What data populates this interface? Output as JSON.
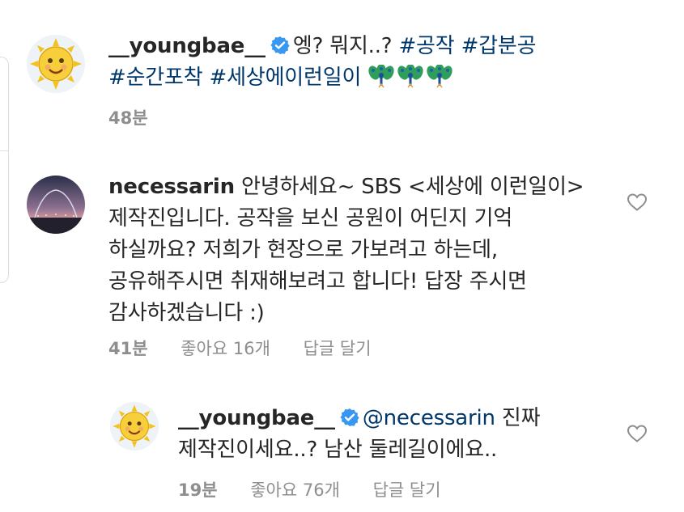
{
  "comments": [
    {
      "username": "__youngbae__",
      "verified": true,
      "text_plain": "엥? 뭐지..? ",
      "hashtags_line1": [
        "#공작",
        "#갑분공"
      ],
      "hashtags_line2": [
        "#순간포착",
        "#세상에이런일이"
      ],
      "emoji": [
        "peacock",
        "peacock",
        "peacock"
      ],
      "time": "48분"
    },
    {
      "username": "necessarin",
      "verified": false,
      "lines": [
        "안녕하세요~ SBS <세상에 이런일이>",
        "제작진입니다. 공작을 보신 공원이 어딘지 기억",
        "하실까요? 저희가 현장으로 가보려고 하는데,",
        "공유해주시면 취재해보려고 합니다! 답장 주시면",
        "감사하겠습니다 :)"
      ],
      "time": "41분",
      "likes": "좋아요 16개",
      "reply": "답글 달기"
    },
    {
      "username": "__youngbae__",
      "verified": true,
      "mention": "@necessarin",
      "line1_rest": " 진짜",
      "line2": "제작진이세요..? 남산 둘레길이에요..",
      "time": "19분",
      "likes": "좋아요 76개",
      "reply": "답글 달기"
    }
  ],
  "colors": {
    "link": "#00376b",
    "meta": "#8e8e8e",
    "verified": "#3897f0",
    "text": "#262626"
  }
}
